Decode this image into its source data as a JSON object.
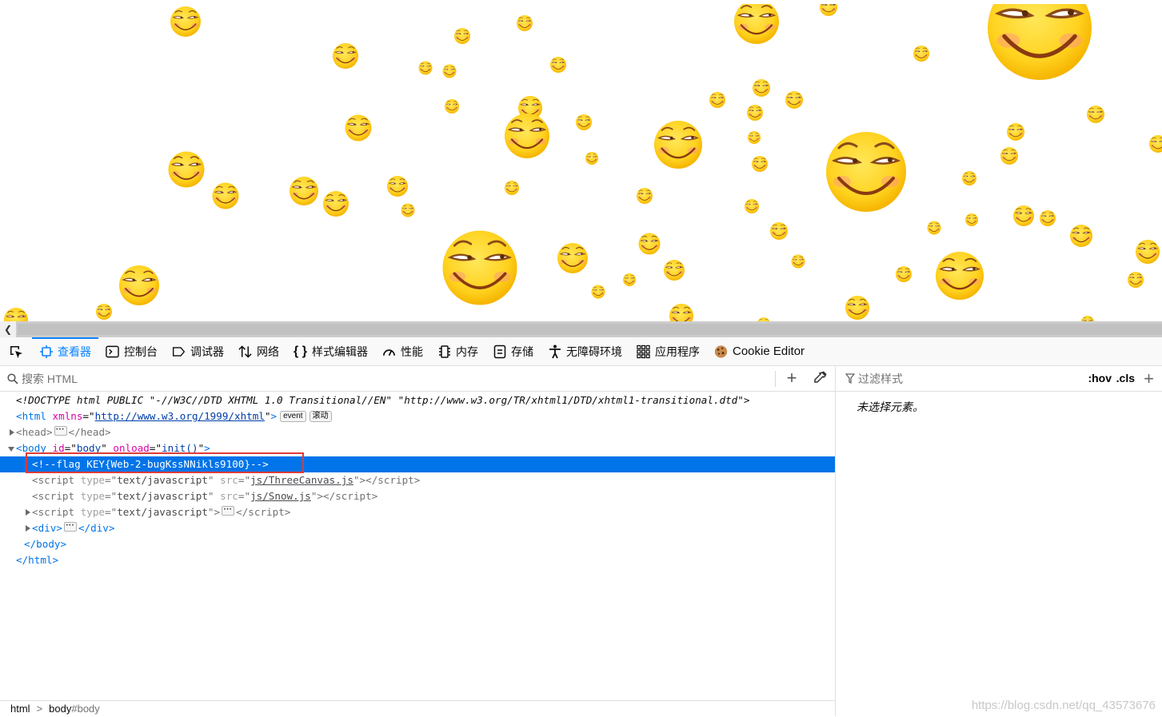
{
  "toolbar": {
    "tabs": [
      {
        "label": "查看器",
        "icon": "inspector-icon",
        "active": true
      },
      {
        "label": "控制台",
        "icon": "console-icon"
      },
      {
        "label": "调试器",
        "icon": "debugger-icon"
      },
      {
        "label": "网络",
        "icon": "network-icon"
      },
      {
        "label": "样式编辑器",
        "icon": "style-editor-icon"
      },
      {
        "label": "性能",
        "icon": "performance-icon"
      },
      {
        "label": "内存",
        "icon": "memory-icon"
      },
      {
        "label": "存储",
        "icon": "storage-icon"
      },
      {
        "label": "无障碍环境",
        "icon": "accessibility-icon"
      },
      {
        "label": "应用程序",
        "icon": "application-icon"
      },
      {
        "label": "Cookie Editor",
        "icon": "cookie-icon"
      }
    ]
  },
  "inspector": {
    "search_placeholder": "搜索 HTML",
    "doctype": "<!DOCTYPE html PUBLIC \"-//W3C//DTD XHTML 1.0 Transitional//EN\" \"http://www.w3.org/TR/xhtml1/DTD/xhtml1-transitional.dtd\">",
    "html_tag": "html",
    "xmlns_attr": "xmlns",
    "xmlns_val": "http://www.w3.org/1999/xhtml",
    "badge_event": "event",
    "badge_scroll": "滚动",
    "head_tag": "head",
    "body_tag": "body",
    "body_id_attr": "id",
    "body_id_val": "body",
    "body_onload_attr": "onload",
    "body_onload_val": "init()",
    "comment": "<!--flag KEY{Web-2-bugKssNNikls9100}-->",
    "script_tag": "script",
    "type_attr": "type",
    "type_val": "text/javascript",
    "src_attr": "src",
    "script1_src": "js/ThreeCanvas.js",
    "script2_src": "js/Snow.js",
    "div_tag": "div",
    "breadcrumbs": [
      "html",
      "body",
      "#body"
    ]
  },
  "rules": {
    "filter_placeholder": "过滤样式",
    "hov": ":hov",
    "cls": ".cls",
    "empty_text": "未选择元素。"
  },
  "watermark": "https://blog.csdn.net/qq_43573676",
  "colors": {
    "accent": "#0a84ff",
    "selection": "#0074e8",
    "highlight_box": "#e03a3a",
    "emoji_face": "#ffd21f"
  }
}
